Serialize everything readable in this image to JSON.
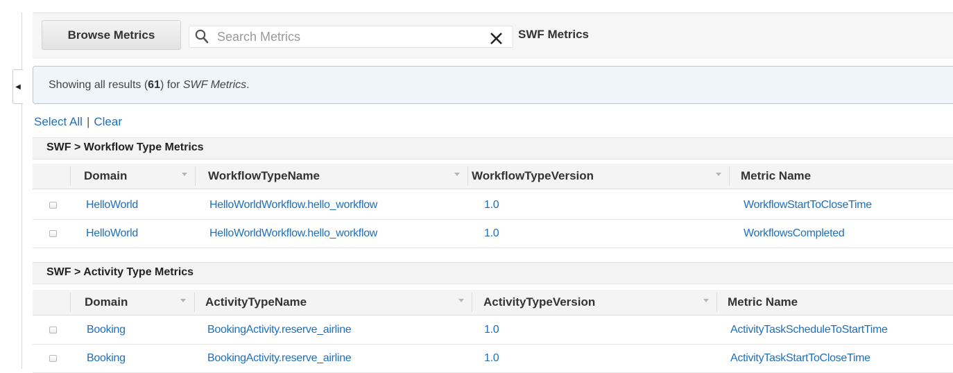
{
  "toolbar": {
    "browse_label": "Browse Metrics",
    "search_placeholder": "Search Metrics",
    "search_value": "",
    "current_view": "SWF Metrics"
  },
  "info": {
    "prefix": "Showing all results (",
    "count": "61",
    "middle": ") for ",
    "query": "SWF Metrics",
    "suffix": "."
  },
  "selection": {
    "select_all": "Select All",
    "separator": "|",
    "clear": "Clear"
  },
  "workflow_group": {
    "title": "SWF > Workflow Type Metrics",
    "columns": [
      "Domain",
      "WorkflowTypeName",
      "WorkflowTypeVersion",
      "Metric Name"
    ],
    "rows": [
      [
        "HelloWorld",
        "HelloWorldWorkflow.hello_workflow",
        "1.0",
        "WorkflowStartToCloseTime"
      ],
      [
        "HelloWorld",
        "HelloWorldWorkflow.hello_workflow",
        "1.0",
        "WorkflowsCompleted"
      ]
    ]
  },
  "activity_group": {
    "title": "SWF > Activity Type Metrics",
    "columns": [
      "Domain",
      "ActivityTypeName",
      "ActivityTypeVersion",
      "Metric Name"
    ],
    "rows": [
      [
        "Booking",
        "BookingActivity.reserve_airline",
        "1.0",
        "ActivityTaskScheduleToStartTime"
      ],
      [
        "Booking",
        "BookingActivity.reserve_airline",
        "1.0",
        "ActivityTaskStartToCloseTime"
      ]
    ]
  },
  "icons": {
    "collapse": "chevron-left-icon",
    "search": "search-icon",
    "clear": "close-icon",
    "sort": "sort-caret-icon",
    "checkbox": "checkbox-icon"
  },
  "colors": {
    "link": "#1f6fb8",
    "info_bg": "#eef6fc",
    "info_border": "#a9cce6"
  }
}
